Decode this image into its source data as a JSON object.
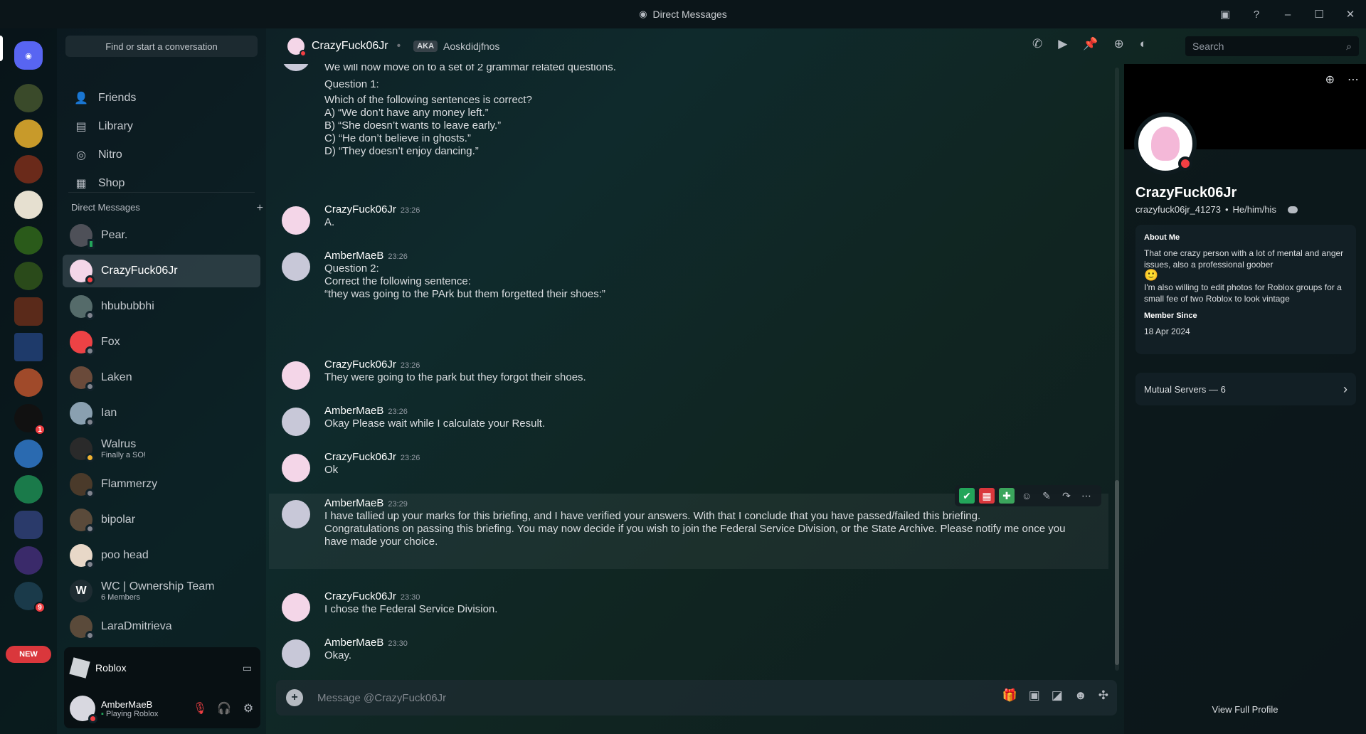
{
  "window": {
    "title": "Direct Messages",
    "colors": {
      "accent": "#5865f2",
      "dnd": "#f23f43",
      "online": "#23a55a",
      "new_badge": "#da373c"
    }
  },
  "rail": {
    "new_label": "NEW",
    "badges": [
      "1",
      "9"
    ]
  },
  "sidebar": {
    "find_placeholder": "Find or start a conversation",
    "nav": [
      {
        "label": "Friends",
        "icon": "friends-icon"
      },
      {
        "label": "Library",
        "icon": "library-icon"
      },
      {
        "label": "Nitro",
        "icon": "nitro-icon"
      },
      {
        "label": "Shop",
        "icon": "shop-icon"
      }
    ],
    "dm_header": "Direct Messages",
    "dms": [
      {
        "name": "Pear.",
        "sub": ""
      },
      {
        "name": "CrazyFuck06Jr",
        "sub": ""
      },
      {
        "name": "hbububbhi",
        "sub": ""
      },
      {
        "name": "Fox",
        "sub": ""
      },
      {
        "name": "Laken",
        "sub": ""
      },
      {
        "name": "Ian",
        "sub": ""
      },
      {
        "name": "Walrus",
        "sub": "Finally a SO!"
      },
      {
        "name": "Flammerzy",
        "sub": ""
      },
      {
        "name": "bipolar",
        "sub": ""
      },
      {
        "name": "poo head",
        "sub": ""
      },
      {
        "name": "WC | Ownership Team",
        "sub": "6 Members"
      },
      {
        "name": "LaraDmitrieva",
        "sub": ""
      }
    ],
    "activity": "Roblox",
    "user": {
      "name": "AmberMaeB",
      "status": "Playing Roblox"
    }
  },
  "header": {
    "name": "CrazyFuck06Jr",
    "aka": "AKA",
    "aka_name": "Aoskdidjfnos",
    "search_placeholder": "Search"
  },
  "messages": [
    {
      "author": "",
      "time": "",
      "lines": [
        "We will now move on to a set of 2 grammar related questions.",
        "Question 1:",
        "Which of the following sentences is correct?",
        "",
        "A) “We don’t have any money left.”",
        "B) “She doesn’t wants to leave early.”",
        "C) “He don’t believe in ghosts.”",
        "D) “They doesn’t enjoy dancing.”"
      ]
    },
    {
      "author": "CrazyFuck06Jr",
      "time": "23:26",
      "lines": [
        "A."
      ]
    },
    {
      "author": "AmberMaeB",
      "time": "23:26",
      "lines": [
        "Question 2:",
        "",
        "Correct the following sentence:",
        "",
        "“they was going to the PArk but them forgetted their shoes:”"
      ]
    },
    {
      "author": "CrazyFuck06Jr",
      "time": "23:26",
      "lines": [
        "They were going to the park but they forgot their shoes."
      ]
    },
    {
      "author": "AmberMaeB",
      "time": "23:26",
      "lines": [
        "Okay Please wait while I calculate your Result."
      ]
    },
    {
      "author": "CrazyFuck06Jr",
      "time": "23:26",
      "lines": [
        "Ok"
      ]
    },
    {
      "author": "AmberMaeB",
      "time": "23:29",
      "lines": [
        "I have tallied up your marks for this briefing, and I have verified your answers. With that I conclude that you have passed/failed this briefing.",
        "",
        "Congratulations on passing this briefing. You may now decide if you wish to join the Federal Service Division, or the State Archive. Please notify me once you",
        "have made your choice."
      ]
    },
    {
      "author": "CrazyFuck06Jr",
      "time": "23:30",
      "lines": [
        "I chose the Federal Service Division."
      ]
    },
    {
      "author": "AmberMaeB",
      "time": "23:30",
      "lines": [
        "Okay."
      ]
    }
  ],
  "composer": {
    "placeholder": "Message @CrazyFuck06Jr"
  },
  "profile": {
    "display_name": "CrazyFuck06Jr",
    "username": "crazyfuck06jr_41273",
    "pronouns": "He/him/his",
    "about_title": "About Me",
    "about_1": "That one crazy person with a lot of mental and anger issues, also a professional goober",
    "about_emoji": "🙂",
    "about_2": "I'm also willing to edit photos for Roblox groups for a small fee of two Roblox to look vintage",
    "member_since_title": "Member Since",
    "member_since": "18 Apr 2024",
    "mutual": "Mutual Servers — 6",
    "view_full": "View Full Profile"
  }
}
